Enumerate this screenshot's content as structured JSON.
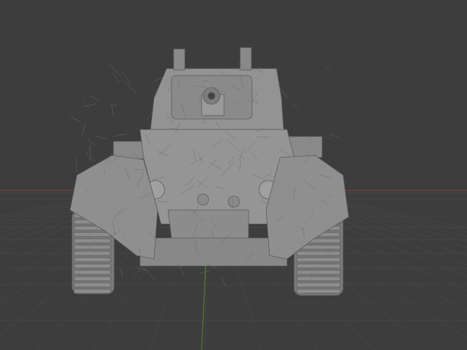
{
  "viewport": {
    "background": "#3d3d3d",
    "grid_color": "#454545",
    "x_axis_color": "#8a3a3a",
    "y_axis_color": "#5a8a2a"
  },
  "model": {
    "fill": "#8e8e8e",
    "shade": "#6f6f6f",
    "wire": "#5a5a5a"
  }
}
